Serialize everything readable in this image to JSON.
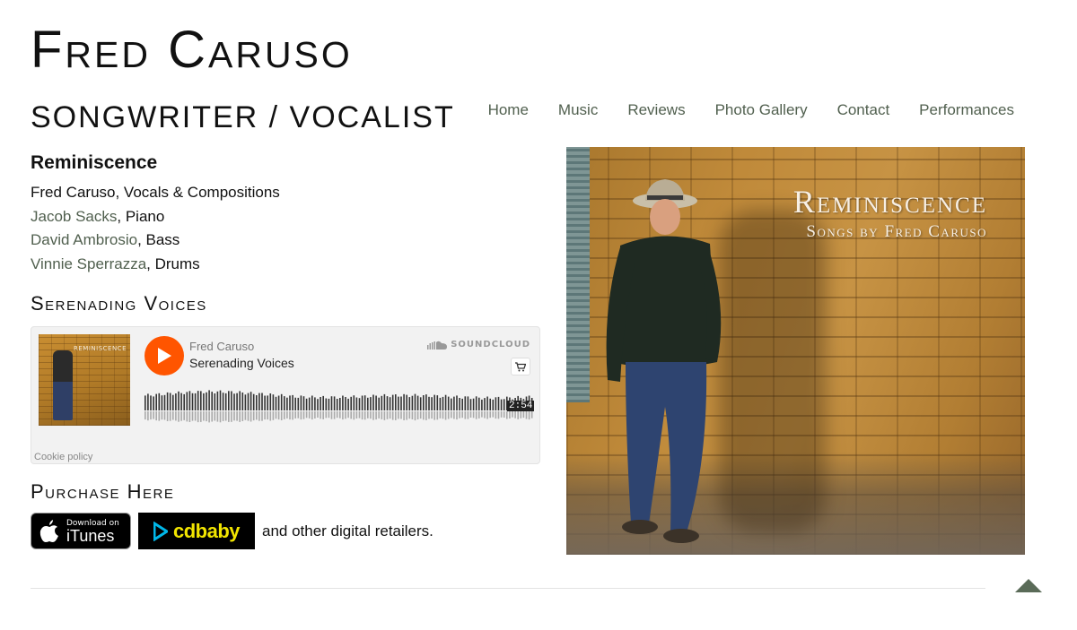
{
  "site": {
    "title": "Fred Caruso",
    "tagline": "SONGWRITER / VOCALIST"
  },
  "nav": {
    "items": [
      {
        "label": "Home"
      },
      {
        "label": "Music"
      },
      {
        "label": "Reviews"
      },
      {
        "label": "Photo Gallery"
      },
      {
        "label": "Contact"
      },
      {
        "label": "Performances"
      }
    ]
  },
  "album": {
    "title": "Reminiscence",
    "credits": [
      {
        "name": "Fred Caruso",
        "role": ", Vocals & Compositions"
      },
      {
        "name": "Jacob Sacks",
        "role": ", Piano"
      },
      {
        "name": "David Ambrosio",
        "role": ", Bass"
      },
      {
        "name": "Vinnie Sperrazza",
        "role": ", Drums"
      }
    ]
  },
  "song_section": {
    "title": "Serenading Voices"
  },
  "player": {
    "artist": "Fred Caruso",
    "track": "Serenading Voices",
    "brand": "SOUNDCLOUD",
    "duration": "2:54",
    "cookie_link": "Cookie policy",
    "art_text": "REMINISCENCE",
    "accent_color": "#ff5500"
  },
  "purchase": {
    "title": "Purchase Here",
    "itunes_small": "Download on",
    "itunes_big": "iTunes",
    "cdbaby_text": "cdbaby",
    "note": "and other digital retailers."
  },
  "photo": {
    "title": "Reminiscence",
    "subtitle": "Songs by Fred Caruso"
  },
  "colors": {
    "link": "#51604f",
    "accent": "#5a6b58"
  }
}
